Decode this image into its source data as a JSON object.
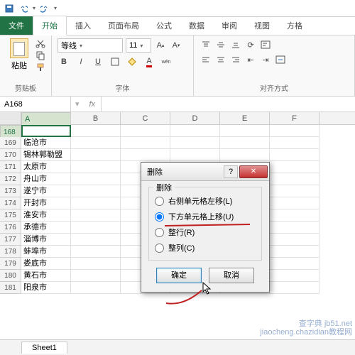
{
  "qat": {
    "save": "save-icon",
    "undo": "undo-icon",
    "redo": "redo-icon"
  },
  "tabs": {
    "file": "文件",
    "home": "开始",
    "insert": "插入",
    "layout": "页面布局",
    "formula": "公式",
    "data": "数据",
    "review": "审阅",
    "view": "视图",
    "format": "方格"
  },
  "ribbon": {
    "clipboard": {
      "label": "剪贴板",
      "paste": "粘贴"
    },
    "font": {
      "label": "字体",
      "name": "等线",
      "size": "11",
      "bold": "B",
      "italic": "I",
      "underline": "U"
    },
    "align": {
      "label": "对齐方式"
    }
  },
  "namebox": {
    "ref": "A168",
    "fx": "fx"
  },
  "cols": [
    "A",
    "B",
    "C",
    "D",
    "E",
    "F"
  ],
  "rows": [
    {
      "n": 168,
      "a": ""
    },
    {
      "n": 169,
      "a": "临沧市"
    },
    {
      "n": 170,
      "a": "锡林郭勒盟"
    },
    {
      "n": 171,
      "a": "太原市"
    },
    {
      "n": 172,
      "a": "舟山市"
    },
    {
      "n": 173,
      "a": "遂宁市"
    },
    {
      "n": 174,
      "a": "开封市"
    },
    {
      "n": 175,
      "a": "淮安市"
    },
    {
      "n": 176,
      "a": "承德市"
    },
    {
      "n": 177,
      "a": "淄博市"
    },
    {
      "n": 178,
      "a": "蚌埠市"
    },
    {
      "n": 179,
      "a": "娄底市"
    },
    {
      "n": 180,
      "a": "黄石市"
    },
    {
      "n": 181,
      "a": "阳泉市"
    }
  ],
  "dialog": {
    "title": "删除",
    "legend": "删除",
    "opt_left": "右侧单元格左移(L)",
    "opt_up": "下方单元格上移(U)",
    "opt_row": "整行(R)",
    "opt_col": "整列(C)",
    "selected": "opt_up",
    "ok": "确定",
    "cancel": "取消"
  },
  "sheet": {
    "name": "Sheet1"
  },
  "watermark": {
    "l1": "查字典 jb51.net",
    "l2": "jiaocheng.chazidian教程网"
  }
}
